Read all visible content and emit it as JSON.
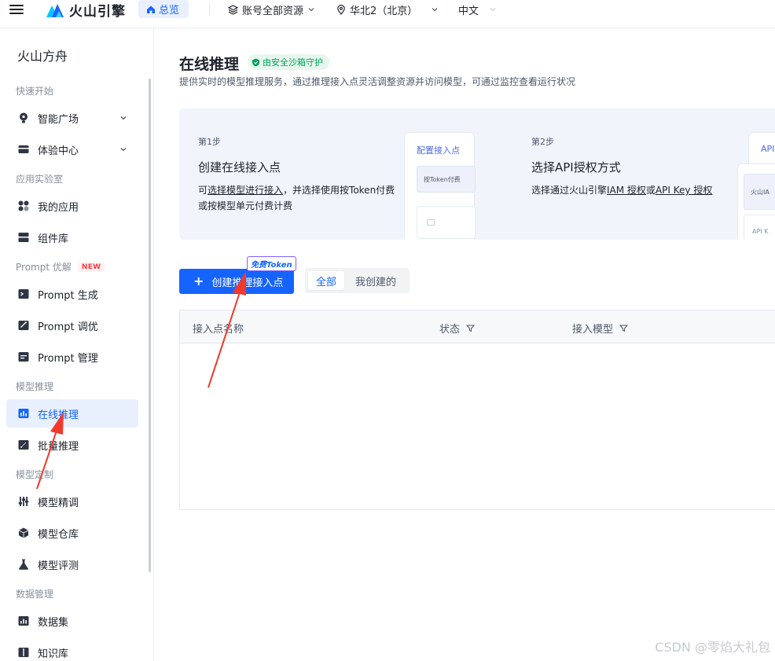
{
  "topbar": {
    "brand": "火山引擎",
    "overview_tab": "总览",
    "account_select": "账号全部资源",
    "region_select": "华北2（北京）",
    "language_select": "中文"
  },
  "sidebar": {
    "title": "火山方舟",
    "groups": {
      "quickstart": "快速开始",
      "applab": "应用实验室",
      "prompt": "Prompt 优解",
      "prompt_badge": "NEW",
      "inference": "模型推理",
      "customize": "模型定制",
      "data": "数据管理"
    },
    "items": {
      "smart_square": "智能广场",
      "experience_center": "体验中心",
      "my_apps": "我的应用",
      "component_lib": "组件库",
      "prompt_generate": "Prompt 生成",
      "prompt_tune": "Prompt 调优",
      "prompt_manage": "Prompt 管理",
      "online_inference": "在线推理",
      "batch_inference": "批量推理",
      "fine_tune": "模型精调",
      "model_repo": "模型仓库",
      "model_eval": "模型评测",
      "dataset": "数据集",
      "knowledge_base": "知识库"
    }
  },
  "main": {
    "title": "在线推理",
    "sandbox_badge": "由安全沙箱守护",
    "description": "提供实时的模型推理服务，通过推理接入点灵活调整资源并访问模型，可通过监控查看运行状况",
    "step1": {
      "label": "第1步",
      "title": "创建在线接入点",
      "desc_prefix": "可",
      "desc_link": "选择模型进行接入",
      "desc_suffix": "，并选择使用按Token付费",
      "desc_line2": "或按模型单元付费计费",
      "preview_head": "配置接入点",
      "preview_chip": "按Token付费"
    },
    "step2": {
      "label": "第2步",
      "title": "选择API授权方式",
      "desc_prefix": "选择通过火山引擎",
      "desc_link1": "IAM 授权",
      "desc_mid": "或",
      "desc_link2": "API Key 授权",
      "preview_head": "API",
      "preview_chip1": "火山IA",
      "preview_chip2": "API K"
    },
    "create_button": "创建推理接入点",
    "free_token_tag": "免费Token",
    "filter_tabs": [
      "全部",
      "我创建的"
    ],
    "table_headers": {
      "name": "接入点名称",
      "status": "状态",
      "model": "接入模型"
    }
  },
  "colors": {
    "accent": "#1664ff",
    "annotation_arrow": "#f03a2e",
    "sandbox_green": "#00a35c"
  },
  "watermark": "CSDN @零焰大礼包"
}
